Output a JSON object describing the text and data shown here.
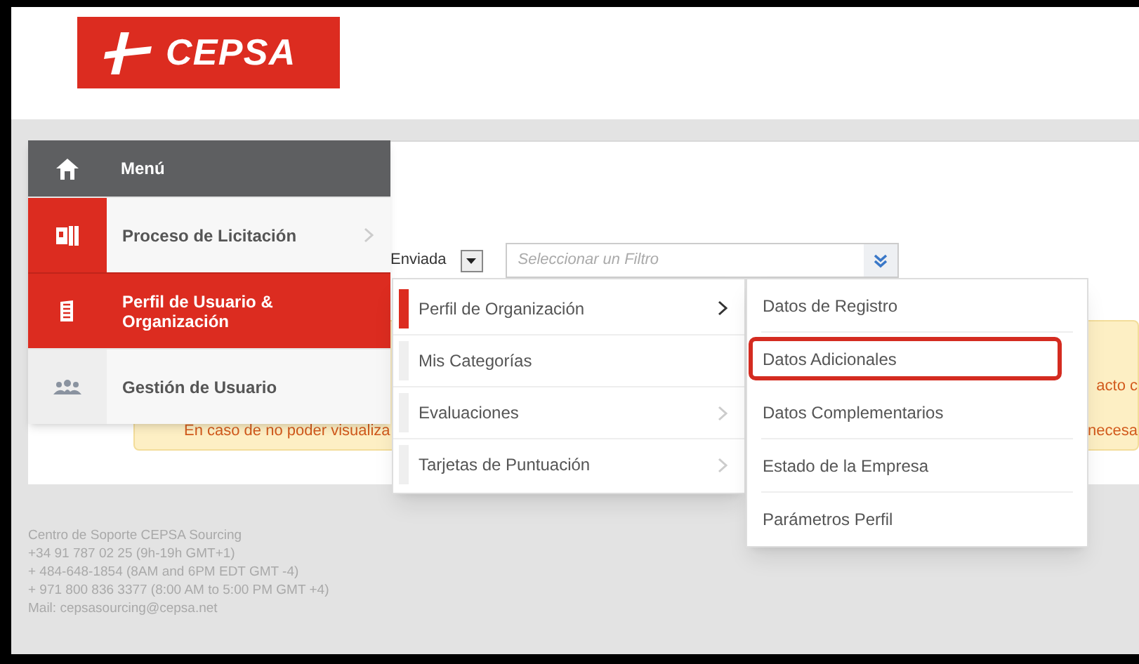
{
  "logo": {
    "text": "CEPSA"
  },
  "filter_bar": {
    "status": "Enviada",
    "filter_placeholder": "Seleccionar un Filtro"
  },
  "notice": {
    "line_1_end": "acto c",
    "line_2_start": "En caso de no poder visualiza",
    "line_2_end": "necesa"
  },
  "menu": {
    "title": "Menú",
    "items": [
      {
        "label": "Proceso de Licitación",
        "selected": false,
        "has_submenu": true
      },
      {
        "label": "Perfil de Usuario & Organización",
        "selected": true,
        "has_submenu": false
      },
      {
        "label": "Gestión de Usuario",
        "selected": false,
        "has_submenu": false
      }
    ]
  },
  "submenu": {
    "items": [
      {
        "label": "Perfil de Organización",
        "selected": true,
        "has_submenu": true
      },
      {
        "label": "Mis Categorías",
        "selected": false,
        "has_submenu": false
      },
      {
        "label": "Evaluaciones",
        "selected": false,
        "has_submenu": true
      },
      {
        "label": "Tarjetas de Puntuación",
        "selected": false,
        "has_submenu": true
      }
    ]
  },
  "sub_submenu": {
    "items": [
      {
        "label": "Datos de Registro",
        "highlighted": false
      },
      {
        "label": "Datos Adicionales",
        "highlighted": true
      },
      {
        "label": "Datos Complementarios",
        "highlighted": false
      },
      {
        "label": "Estado de la Empresa",
        "highlighted": false
      },
      {
        "label": "Parámetros Perfil",
        "highlighted": false
      }
    ]
  },
  "footer": {
    "lines": [
      "Centro de Soporte CEPSA Sourcing",
      "+34 91 787 02 25 (9h-19h GMT+1)",
      "+ 484-648-1854 (8AM and 6PM EDT GMT -4)",
      "+ 971 800 836 3377 (8:00 AM to 5:00 PM GMT +4)",
      "Mail: cepsasourcing@cepsa.net"
    ]
  }
}
